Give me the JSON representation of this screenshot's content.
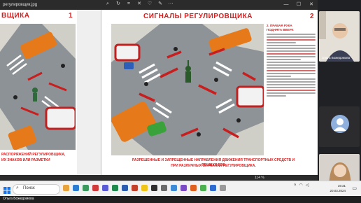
{
  "viewer": {
    "filename": "регулировщик.jpg",
    "zoom": "114 %"
  },
  "image": {
    "left_title": "ВЩИКА",
    "left_num": "1",
    "right_title": "СИГНАЛЫ РЕГУЛИРОВЩИКА",
    "right_num": "2",
    "left_footer_1": "РАСПОРЯЖЕНИЙ РЕГУЛИРОВЩИКА,",
    "left_footer_2": "ИХ ЗНАКОВ ИЛИ РАЗМЕТКИ",
    "right_footer_1": "РАЗРЕШЕННЫЕ И ЗАПРЕЩЕННЫЕ НАПРАВЛЕНИЯ ДВИЖЕНИЯ ТРАНСПОРТНЫХ СРЕДСТВ И ПЕШЕХОДОВ",
    "right_footer_2": "ПРИ РАЗЛИЧНЫХ СИГНАЛАХ РЕГУЛИРОВЩИКА.",
    "text_heading_1": "2. ПРАВАЯ РУКА",
    "text_heading_2": "ПОДНЯТА ВВЕРХ"
  },
  "participants": [
    {
      "name": "Ольга Божедомова"
    },
    {
      "name": ""
    },
    {
      "name": "Полина Шмырина"
    }
  ],
  "taskbar": {
    "search_placeholder": "Поиск",
    "time": "19:31",
    "date": "20.03.2024"
  },
  "bottom": {
    "presenter": "Ольга Божедомова"
  }
}
